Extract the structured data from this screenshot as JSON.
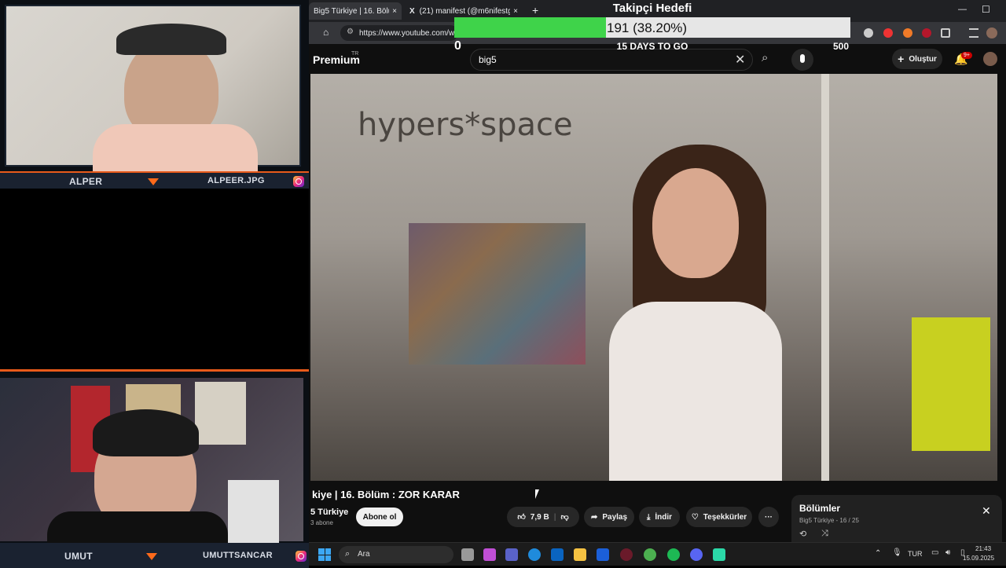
{
  "stream": {
    "top_cam": {
      "left_name": "ALPER",
      "right_name": "ALPEER.JPG"
    },
    "bottom_cam": {
      "left_name": "UMUT",
      "right_name": "UMUTTSANCAR"
    }
  },
  "goal": {
    "title": "Takipçi Hedefi",
    "progress_text": "191 (38.20%)",
    "progress_fraction": 0.382,
    "min_label": "0",
    "max_label": "500",
    "days_text": "15 DAYS TO GO",
    "fill_color": "#3fd34a"
  },
  "browser": {
    "tabs": [
      {
        "label": "Big5 Türkiye | 16. Bölüm",
        "close": "×"
      },
      {
        "label": "(21) manifest (@m6nifestgirls)",
        "close": "×"
      }
    ],
    "new_tab": "+",
    "url": "https://www.youtube.com/wa",
    "window_controls": {
      "minimize": "—",
      "maximize": "☐"
    }
  },
  "youtube": {
    "logo_text": "Premium",
    "logo_sup": "TR",
    "search_value": "big5",
    "create_label": "Oluştur",
    "notif_badge": "9+",
    "video_watermark": "hypers*space",
    "video_title": "kiye | 16. Bölüm : ZOR KARAR",
    "channel_name": "5 Türkiye",
    "subscribers": "3 abone",
    "subscribe_label": "Abone ol",
    "like_count": "7,9 B",
    "share_label": "Paylaş",
    "download_label": "İndir",
    "thanks_label": "Teşekkürler",
    "more_label": "···",
    "playlist": {
      "title": "Bölümler",
      "subtitle": "Big5 Türkiye - 16 / 25"
    }
  },
  "taskbar": {
    "search_label": "Ara",
    "language": "TUR",
    "time": "21:43",
    "date": "15.09.2025"
  }
}
